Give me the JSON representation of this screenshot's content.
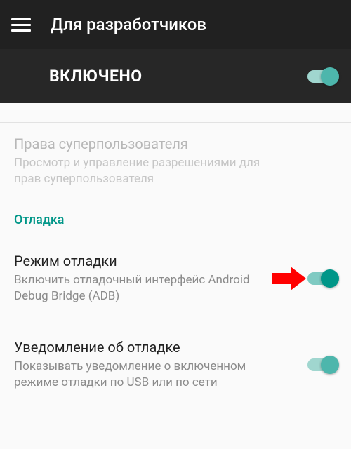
{
  "header": {
    "title": "Для разработчиков"
  },
  "master": {
    "label": "ВКЛЮЧЕНО",
    "enabled": true
  },
  "superuser": {
    "title": "Права суперпользователя",
    "subtitle": "Просмотр и управление разрешениями для прав суперпользователя"
  },
  "section_debug_label": "Отладка",
  "debug_mode": {
    "title": "Режим отладки",
    "subtitle": "Включить отладочный интерфейс Android Debug Bridge (ADB)",
    "enabled": true
  },
  "debug_notification": {
    "title": "Уведомление об отладке",
    "subtitle": "Показывать уведомление о включенном режиме отладки по USB или по сети",
    "enabled": true
  },
  "colors": {
    "accent": "#009688",
    "appbar": "#212121"
  },
  "annotation": {
    "arrow_target": "debug-mode-switch",
    "arrow_color": "#ff0000"
  }
}
